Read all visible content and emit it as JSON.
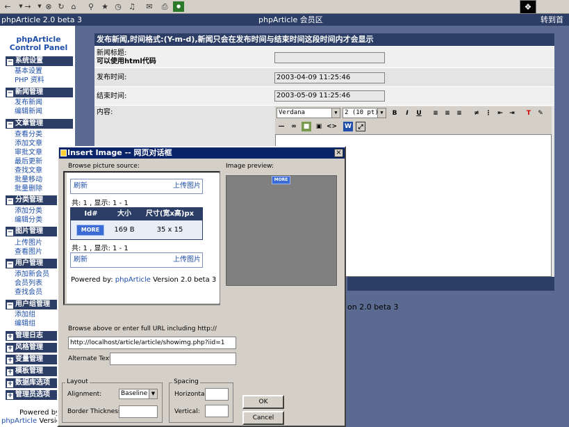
{
  "toolbar": {
    "icons": [
      "back-icon",
      "forward-icon",
      "stop-icon",
      "refresh-icon",
      "home-icon",
      "search-icon",
      "favorites-icon",
      "history-icon",
      "mail-icon",
      "print-icon",
      "messenger-icon"
    ]
  },
  "topbar": {
    "left": "phpArticle 2.0 beta 3",
    "center": "phpArticle 会员区",
    "right": "转到首页"
  },
  "sidebar": {
    "logo_line1": "phpArticle",
    "logo_line2": "Control Panel",
    "sections": [
      {
        "title": "系统设置",
        "items": [
          "基本设置",
          "PHP 资料"
        ]
      },
      {
        "title": "新闻管理",
        "items": [
          "发布新闻",
          "编辑新闻"
        ]
      },
      {
        "title": "文章管理",
        "items": [
          "查看分类",
          "添加文章",
          "审批文章",
          "最后更新",
          "查找文章",
          "批量移动",
          "批量删除"
        ]
      },
      {
        "title": "分类管理",
        "items": [
          "添加分类",
          "编辑分类"
        ]
      },
      {
        "title": "图片管理",
        "items": [
          "上传图片",
          "查看图片"
        ]
      },
      {
        "title": "用户管理",
        "items": [
          "添加新会员",
          "会员列表",
          "查找会员"
        ]
      },
      {
        "title": "用户组管理",
        "items": [
          "添加组",
          "编辑组"
        ]
      },
      {
        "title": "管理日志",
        "items": []
      },
      {
        "title": "风格管理",
        "items": []
      },
      {
        "title": "变量管理",
        "items": []
      },
      {
        "title": "模板管理",
        "items": []
      },
      {
        "title": "数据库选项",
        "items": []
      },
      {
        "title": "管理员选项",
        "items": []
      }
    ],
    "footer_line1": "Powered by",
    "footer_link": "phpArticle",
    "footer_version": "Versio"
  },
  "form": {
    "header": "发布新闻,时间格式:(Y-m-d),新闻只会在发布时间与结束时间这段时间内才会显示",
    "title_label_1": "新闻标题:",
    "title_label_2": "可以使用html代码",
    "title_value": "",
    "publish_label": "发布时间:",
    "publish_value": "2003-04-09 11:25:46",
    "end_label": "结束时间:",
    "end_value": "2003-05-09 11:25:46",
    "content_label": "内容:",
    "font_select": "Verdana",
    "size_select": "2 (10 pt)",
    "bold": "B",
    "italic": "I",
    "underline": "U",
    "footer_text": "on 2.0 beta 3"
  },
  "dialog": {
    "title": "Insert Image -- 网页对话框",
    "close": "×",
    "browse_label": "Browse picture source:",
    "preview_label": "Image preview:",
    "refresh_1": "刷新",
    "upload_1": "上传图片",
    "count_1": "共: 1 , 显示: 1 - 1",
    "table_headers": [
      "Id#",
      "大小",
      "尺寸(宽x高)px"
    ],
    "row": {
      "thumb": "MORE",
      "size": "169 B",
      "dims": "35 x 15"
    },
    "count_2": "共: 1 , 显示: 1 - 1",
    "refresh_2": "刷新",
    "upload_2": "上传图片",
    "powered_by": "Powered by:",
    "powered_link": "phpArticle",
    "powered_version": "Version 2.0 beta 3",
    "preview_thumb": "MORE",
    "url_label": "Browse above or enter full URL including http://",
    "url_value": "http://localhost/article/article/showimg.php?iid=1",
    "alt_label": "Alternate Text:",
    "alt_value": "",
    "layout_legend": "Layout",
    "alignment_label": "Alignment:",
    "alignment_value": "Baseline",
    "border_label": "Border Thickness:",
    "border_value": "",
    "spacing_legend": "Spacing",
    "horizontal_label": "Horizontal:",
    "horizontal_value": "",
    "vertical_label": "Vertical:",
    "vertical_value": "",
    "ok": "OK",
    "cancel": "Cancel"
  }
}
